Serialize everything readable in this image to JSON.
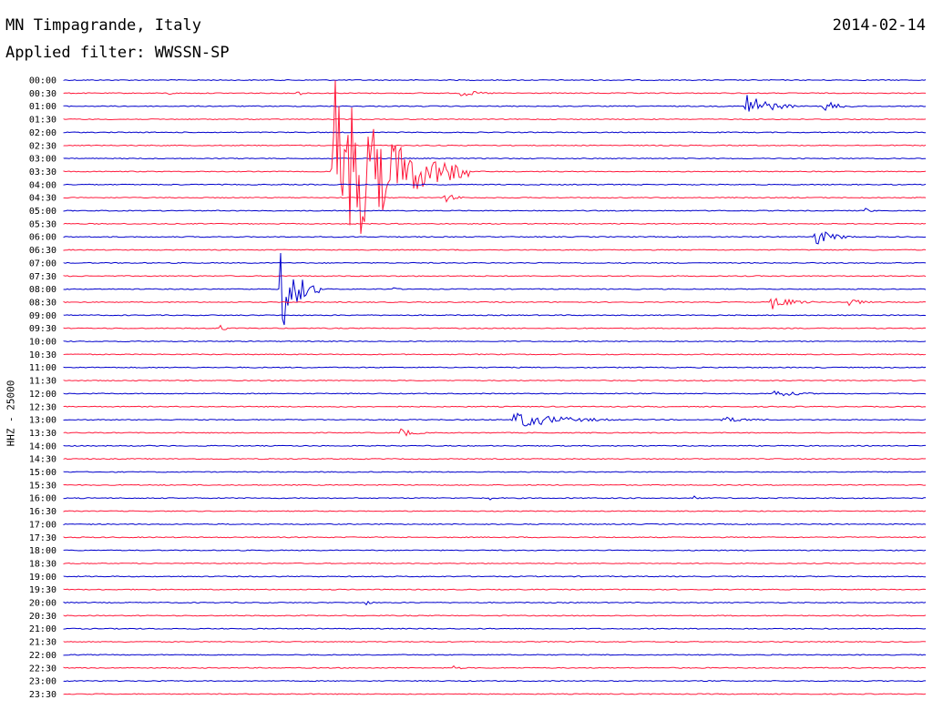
{
  "header": {
    "station": "MN Timpagrande, Italy",
    "date": "2014-02-14",
    "filter": "Applied filter: WWSSN-SP",
    "channel_label": "HHZ - 25000"
  },
  "colors": {
    "trace_even": "#0000cc",
    "trace_odd": "#ff1a3c",
    "background": "#ffffff"
  },
  "chart_data": {
    "type": "line",
    "title": "MN Timpagrande, Italy",
    "xlabel": "",
    "ylabel": "HHZ - 25000",
    "grid": false,
    "rows": [
      {
        "label": "00:00",
        "color": "blue",
        "events": []
      },
      {
        "label": "00:30",
        "color": "red",
        "events": [
          {
            "t": 0.12,
            "amp": 0.2,
            "dur": 0.01
          },
          {
            "t": 0.27,
            "amp": 0.2,
            "dur": 0.015
          },
          {
            "t": 0.46,
            "amp": 0.25,
            "dur": 0.04
          }
        ]
      },
      {
        "label": "01:00",
        "color": "blue",
        "events": [
          {
            "t": 0.79,
            "amp": 1.0,
            "dur": 0.06
          },
          {
            "t": 0.88,
            "amp": 0.4,
            "dur": 0.04
          }
        ]
      },
      {
        "label": "01:30",
        "color": "red",
        "events": []
      },
      {
        "label": "02:00",
        "color": "blue",
        "events": []
      },
      {
        "label": "02:30",
        "color": "red",
        "events": []
      },
      {
        "label": "03:00",
        "color": "blue",
        "events": []
      },
      {
        "label": "03:30",
        "color": "red",
        "events": [
          {
            "t": 0.31,
            "amp": 7.0,
            "dur": 0.16
          }
        ]
      },
      {
        "label": "04:00",
        "color": "blue",
        "events": []
      },
      {
        "label": "04:30",
        "color": "red",
        "events": [
          {
            "t": 0.44,
            "amp": 0.35,
            "dur": 0.03
          }
        ]
      },
      {
        "label": "05:00",
        "color": "blue",
        "events": [
          {
            "t": 0.93,
            "amp": 0.3,
            "dur": 0.01
          }
        ]
      },
      {
        "label": "05:30",
        "color": "red",
        "events": []
      },
      {
        "label": "06:00",
        "color": "blue",
        "events": [
          {
            "t": 0.87,
            "amp": 0.6,
            "dur": 0.05
          }
        ]
      },
      {
        "label": "06:30",
        "color": "red",
        "events": []
      },
      {
        "label": "07:00",
        "color": "blue",
        "events": []
      },
      {
        "label": "07:30",
        "color": "red",
        "events": []
      },
      {
        "label": "08:00",
        "color": "blue",
        "events": [
          {
            "t": 0.25,
            "amp": 3.0,
            "dur": 0.05
          },
          {
            "t": 0.38,
            "amp": 0.2,
            "dur": 0.01
          }
        ]
      },
      {
        "label": "08:30",
        "color": "red",
        "events": [
          {
            "t": 0.82,
            "amp": 0.5,
            "dur": 0.05
          },
          {
            "t": 0.91,
            "amp": 0.3,
            "dur": 0.03
          }
        ]
      },
      {
        "label": "09:00",
        "color": "blue",
        "events": []
      },
      {
        "label": "09:30",
        "color": "red",
        "events": [
          {
            "t": 0.18,
            "amp": 0.6,
            "dur": 0.01
          }
        ]
      },
      {
        "label": "10:00",
        "color": "blue",
        "events": []
      },
      {
        "label": "10:30",
        "color": "red",
        "events": []
      },
      {
        "label": "11:00",
        "color": "blue",
        "events": []
      },
      {
        "label": "11:30",
        "color": "red",
        "events": [
          {
            "t": 0.74,
            "amp": 0.15,
            "dur": 0.01
          }
        ]
      },
      {
        "label": "12:00",
        "color": "blue",
        "events": [
          {
            "t": 0.82,
            "amp": 0.3,
            "dur": 0.05
          }
        ]
      },
      {
        "label": "12:30",
        "color": "red",
        "events": []
      },
      {
        "label": "13:00",
        "color": "blue",
        "events": [
          {
            "t": 0.52,
            "amp": 0.6,
            "dur": 0.12
          },
          {
            "t": 0.76,
            "amp": 0.2,
            "dur": 0.06
          }
        ]
      },
      {
        "label": "13:30",
        "color": "red",
        "events": [
          {
            "t": 0.39,
            "amp": 0.35,
            "dur": 0.03
          }
        ]
      },
      {
        "label": "14:00",
        "color": "blue",
        "events": []
      },
      {
        "label": "14:30",
        "color": "red",
        "events": []
      },
      {
        "label": "15:00",
        "color": "blue",
        "events": []
      },
      {
        "label": "15:30",
        "color": "red",
        "events": []
      },
      {
        "label": "16:00",
        "color": "blue",
        "events": [
          {
            "t": 0.49,
            "amp": 0.35,
            "dur": 0.01
          },
          {
            "t": 0.73,
            "amp": 0.15,
            "dur": 0.01
          }
        ]
      },
      {
        "label": "16:30",
        "color": "red",
        "events": []
      },
      {
        "label": "17:00",
        "color": "blue",
        "events": []
      },
      {
        "label": "17:30",
        "color": "red",
        "events": []
      },
      {
        "label": "18:00",
        "color": "blue",
        "events": []
      },
      {
        "label": "18:30",
        "color": "red",
        "events": []
      },
      {
        "label": "19:00",
        "color": "blue",
        "events": []
      },
      {
        "label": "19:30",
        "color": "red",
        "events": []
      },
      {
        "label": "20:00",
        "color": "blue",
        "events": [
          {
            "t": 0.35,
            "amp": 0.2,
            "dur": 0.01
          }
        ]
      },
      {
        "label": "20:30",
        "color": "red",
        "events": []
      },
      {
        "label": "21:00",
        "color": "blue",
        "events": []
      },
      {
        "label": "21:30",
        "color": "red",
        "events": []
      },
      {
        "label": "22:00",
        "color": "blue",
        "events": []
      },
      {
        "label": "22:30",
        "color": "red",
        "events": [
          {
            "t": 0.45,
            "amp": 0.15,
            "dur": 0.02
          }
        ]
      },
      {
        "label": "23:00",
        "color": "blue",
        "events": []
      },
      {
        "label": "23:30",
        "color": "red",
        "events": []
      }
    ]
  }
}
